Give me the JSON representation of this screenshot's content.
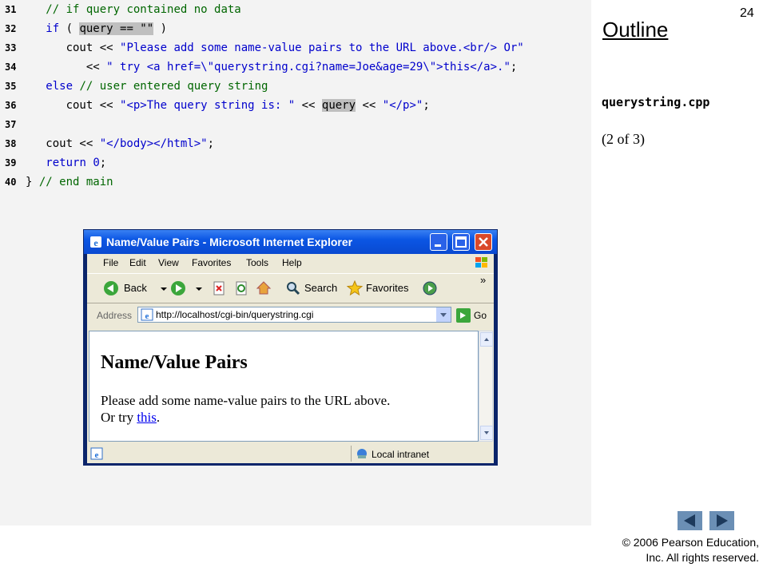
{
  "slide": {
    "number": "24",
    "outline_title": "Outline",
    "filename": "querystring.cpp",
    "part": "(2 of 3)",
    "copyright_line1": "© 2006 Pearson Education,",
    "copyright_line2": "Inc.  All rights reserved."
  },
  "code": [
    {
      "n": "31",
      "segments": [
        {
          "t": "   ",
          "c": ""
        },
        {
          "t": "// if query contained no data",
          "c": "cm"
        }
      ]
    },
    {
      "n": "32",
      "segments": [
        {
          "t": "   ",
          "c": ""
        },
        {
          "t": "if",
          "c": "kw"
        },
        {
          "t": " ( ",
          "c": ""
        },
        {
          "t": "query == \"\"",
          "c": "hl"
        },
        {
          "t": " )",
          "c": ""
        }
      ]
    },
    {
      "n": "33",
      "segments": [
        {
          "t": "      cout << ",
          "c": ""
        },
        {
          "t": "\"Please add some name-value pairs to the URL above.<br/> Or\"",
          "c": "st"
        }
      ]
    },
    {
      "n": "34",
      "segments": [
        {
          "t": "         << ",
          "c": ""
        },
        {
          "t": "\" try <a href=\\\"querystring.cgi?name=Joe&age=29\\\">this</a>.\"",
          "c": "st"
        },
        {
          "t": ";",
          "c": ""
        }
      ]
    },
    {
      "n": "35",
      "segments": [
        {
          "t": "   ",
          "c": ""
        },
        {
          "t": "else",
          "c": "kw"
        },
        {
          "t": " ",
          "c": ""
        },
        {
          "t": "// user entered query string",
          "c": "cm"
        }
      ]
    },
    {
      "n": "36",
      "segments": [
        {
          "t": "      cout << ",
          "c": ""
        },
        {
          "t": "\"<p>The query string is: \"",
          "c": "st"
        },
        {
          "t": " << ",
          "c": ""
        },
        {
          "t": "query",
          "c": "hl"
        },
        {
          "t": " << ",
          "c": ""
        },
        {
          "t": "\"</p>\"",
          "c": "st"
        },
        {
          "t": ";",
          "c": ""
        }
      ]
    },
    {
      "n": "37",
      "segments": []
    },
    {
      "n": "38",
      "segments": [
        {
          "t": "   cout << ",
          "c": ""
        },
        {
          "t": "\"</body></html>\"",
          "c": "st"
        },
        {
          "t": ";",
          "c": ""
        }
      ]
    },
    {
      "n": "39",
      "segments": [
        {
          "t": "   ",
          "c": ""
        },
        {
          "t": "return",
          "c": "kw"
        },
        {
          "t": " ",
          "c": ""
        },
        {
          "t": "0",
          "c": "st"
        },
        {
          "t": ";",
          "c": ""
        }
      ]
    },
    {
      "n": "40",
      "segments": [
        {
          "t": "} ",
          "c": ""
        },
        {
          "t": "// end main",
          "c": "cm"
        }
      ]
    }
  ],
  "browser": {
    "title": "Name/Value Pairs - Microsoft Internet Explorer",
    "menu": [
      "File",
      "Edit",
      "View",
      "Favorites",
      "Tools",
      "Help"
    ],
    "toolbar": {
      "back": "Back",
      "search": "Search",
      "favorites": "Favorites"
    },
    "address_label": "Address",
    "address_value": "http://localhost/cgi-bin/querystring.cgi",
    "go_label": "Go",
    "page_heading": "Name/Value Pairs",
    "page_line1": "Please add some name-value pairs to the URL above.",
    "page_line2_prefix": "Or try ",
    "page_link": "this",
    "page_line2_suffix": ".",
    "status_zone": "Local intranet"
  },
  "colors": {
    "code_bg": "#f3f3f3",
    "keyword": "#0000cc",
    "comment": "#006600",
    "highlight": "#bfbfbf",
    "nav_button": "#6b8fb5",
    "ie_title": "#0b56e4"
  }
}
